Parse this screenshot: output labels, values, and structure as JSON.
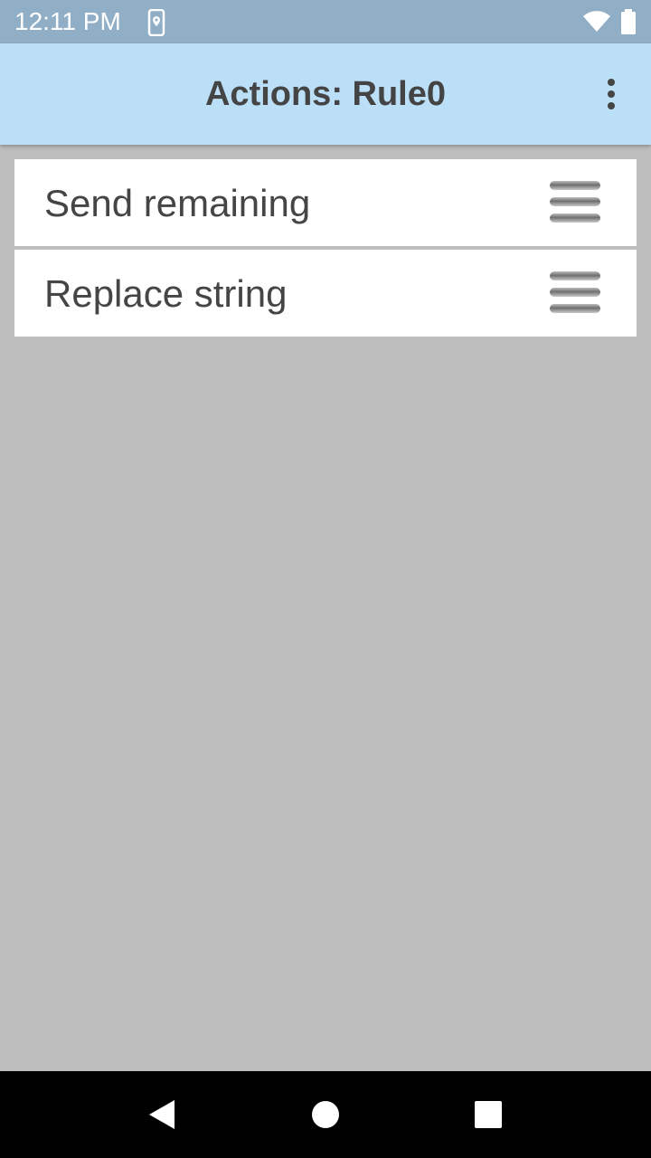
{
  "status_bar": {
    "time": "12:11 PM",
    "icons": [
      "location-phone-icon",
      "wifi-icon",
      "battery-icon"
    ],
    "color": "#91aec7"
  },
  "app_bar": {
    "title": "Actions: Rule0",
    "menu_icon": "more-vertical-icon",
    "color": "#bcdff8"
  },
  "actions": [
    {
      "label": "Send remaining",
      "handle_icon": "drag-handle-icon"
    },
    {
      "label": "Replace string",
      "handle_icon": "drag-handle-icon"
    }
  ],
  "nav_bar": {
    "buttons": [
      "back-icon",
      "home-icon",
      "recents-icon"
    ]
  },
  "colors": {
    "background": "#bdbdbd",
    "card": "#ffffff",
    "text": "#454545"
  }
}
